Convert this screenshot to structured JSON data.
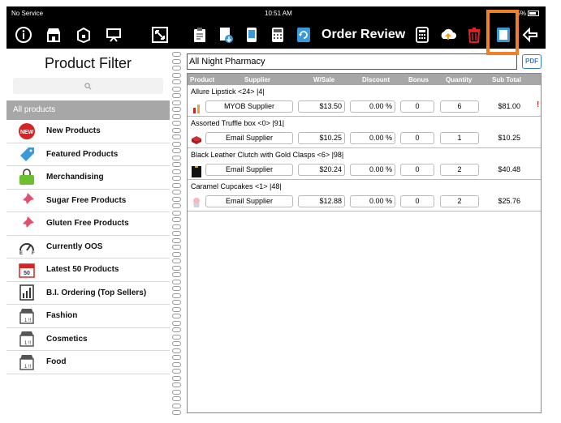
{
  "status_bar": {
    "carrier": "No Service",
    "time": "10:51 AM",
    "battery": "5%"
  },
  "toolbar": {
    "left_icons": [
      "info-icon",
      "store-icon",
      "box-icon",
      "presentation-icon",
      "resize-icon"
    ],
    "order_icons": [
      "clipboard-icon",
      "document-download-icon",
      "mobile-device-icon",
      "calculator-icon",
      "refresh-document-icon"
    ],
    "title": "Order Review",
    "right_icons": [
      "calculator-icon",
      "upload-icon",
      "trash-icon",
      "document-copy-icon",
      "back-arrow-icon"
    ],
    "highlight_color": "#f07f2a"
  },
  "filter": {
    "title": "Product Filter",
    "search_placeholder": "",
    "all_label": "All products",
    "items": [
      {
        "label": "New Products",
        "icon": "new-badge-icon"
      },
      {
        "label": "Featured Products",
        "icon": "tag-icon"
      },
      {
        "label": "Merchandising",
        "icon": "bag-icon"
      },
      {
        "label": "Sugar Free Products",
        "icon": "pin-icon"
      },
      {
        "label": "Gluten Free Products",
        "icon": "pin-icon"
      },
      {
        "label": "Currently OOS",
        "icon": "gauge-icon"
      },
      {
        "label": "Latest 50 Products",
        "icon": "calendar-icon"
      },
      {
        "label": "B.I. Ordering (Top Sellers)",
        "icon": "bar-chart-icon"
      },
      {
        "label": "Fashion",
        "icon": "store-icon"
      },
      {
        "label": "Cosmetics",
        "icon": "store-icon"
      },
      {
        "label": "Food",
        "icon": "store-icon"
      }
    ]
  },
  "order": {
    "customer": "All Night Pharmacy",
    "pdf_label": "PDF",
    "columns": [
      "Product",
      "Supplier",
      "W/Sale",
      "Discount",
      "Bonus",
      "Quantity",
      "Sub Total"
    ],
    "rows": [
      {
        "name": "Allure Lipstick <24> |4|",
        "supplier": "MYOB Supplier",
        "wsale": "$13.50",
        "discount": "0.00 %",
        "bonus": "0",
        "quantity": "6",
        "subtotal": "$81.00",
        "warn": "!"
      },
      {
        "name": "Assorted Truffle box <0> |91|",
        "supplier": "Email Supplier",
        "wsale": "$10.25",
        "discount": "0.00 %",
        "bonus": "0",
        "quantity": "1",
        "subtotal": "$10.25",
        "warn": ""
      },
      {
        "name": "Black Leather Clutch with Gold Clasps <6> |98|",
        "supplier": "Email Supplier",
        "wsale": "$20.24",
        "discount": "0.00 %",
        "bonus": "0",
        "quantity": "2",
        "subtotal": "$40.48",
        "warn": ""
      },
      {
        "name": "Caramel Cupcakes <1> |48|",
        "supplier": "Email Supplier",
        "wsale": "$12.88",
        "discount": "0.00 %",
        "bonus": "0",
        "quantity": "2",
        "subtotal": "$25.76",
        "warn": ""
      }
    ]
  }
}
